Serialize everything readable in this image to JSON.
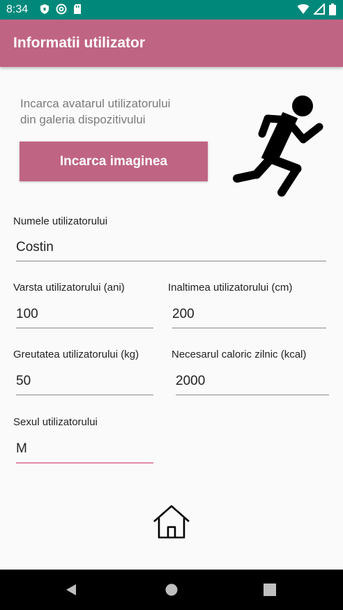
{
  "status_bar": {
    "time": "8:34",
    "icons": [
      "shield-icon",
      "at-icon",
      "sd-card-icon",
      "wifi-icon",
      "signal-icon",
      "battery-icon"
    ]
  },
  "app_bar": {
    "title": "Informatii utilizator",
    "color": "#c06484"
  },
  "avatar_section": {
    "hint_line1": "Incarca avatarul utilizatorului",
    "hint_line2": "din galeria dispozitivului",
    "upload_button": "Incarca imaginea",
    "avatar_icon": "running-man-icon"
  },
  "form": {
    "name": {
      "label": "Numele utilizatorului",
      "value": "Costin"
    },
    "age": {
      "label": "Varsta utilizatorului (ani)",
      "value": "100"
    },
    "height": {
      "label": "Inaltimea utilizatorului (cm)",
      "value": "200"
    },
    "weight": {
      "label": "Greutatea utilizatorului (kg)",
      "value": "50"
    },
    "calories": {
      "label": "Necesarul caloric zilnic (kcal)",
      "value": "2000"
    },
    "sex": {
      "label": "Sexul utilizatorului",
      "value": "M"
    }
  },
  "home_button": {
    "icon": "home-icon"
  },
  "nav_bar": {
    "icons": [
      "back-icon",
      "home-circle-icon",
      "recents-icon"
    ]
  }
}
